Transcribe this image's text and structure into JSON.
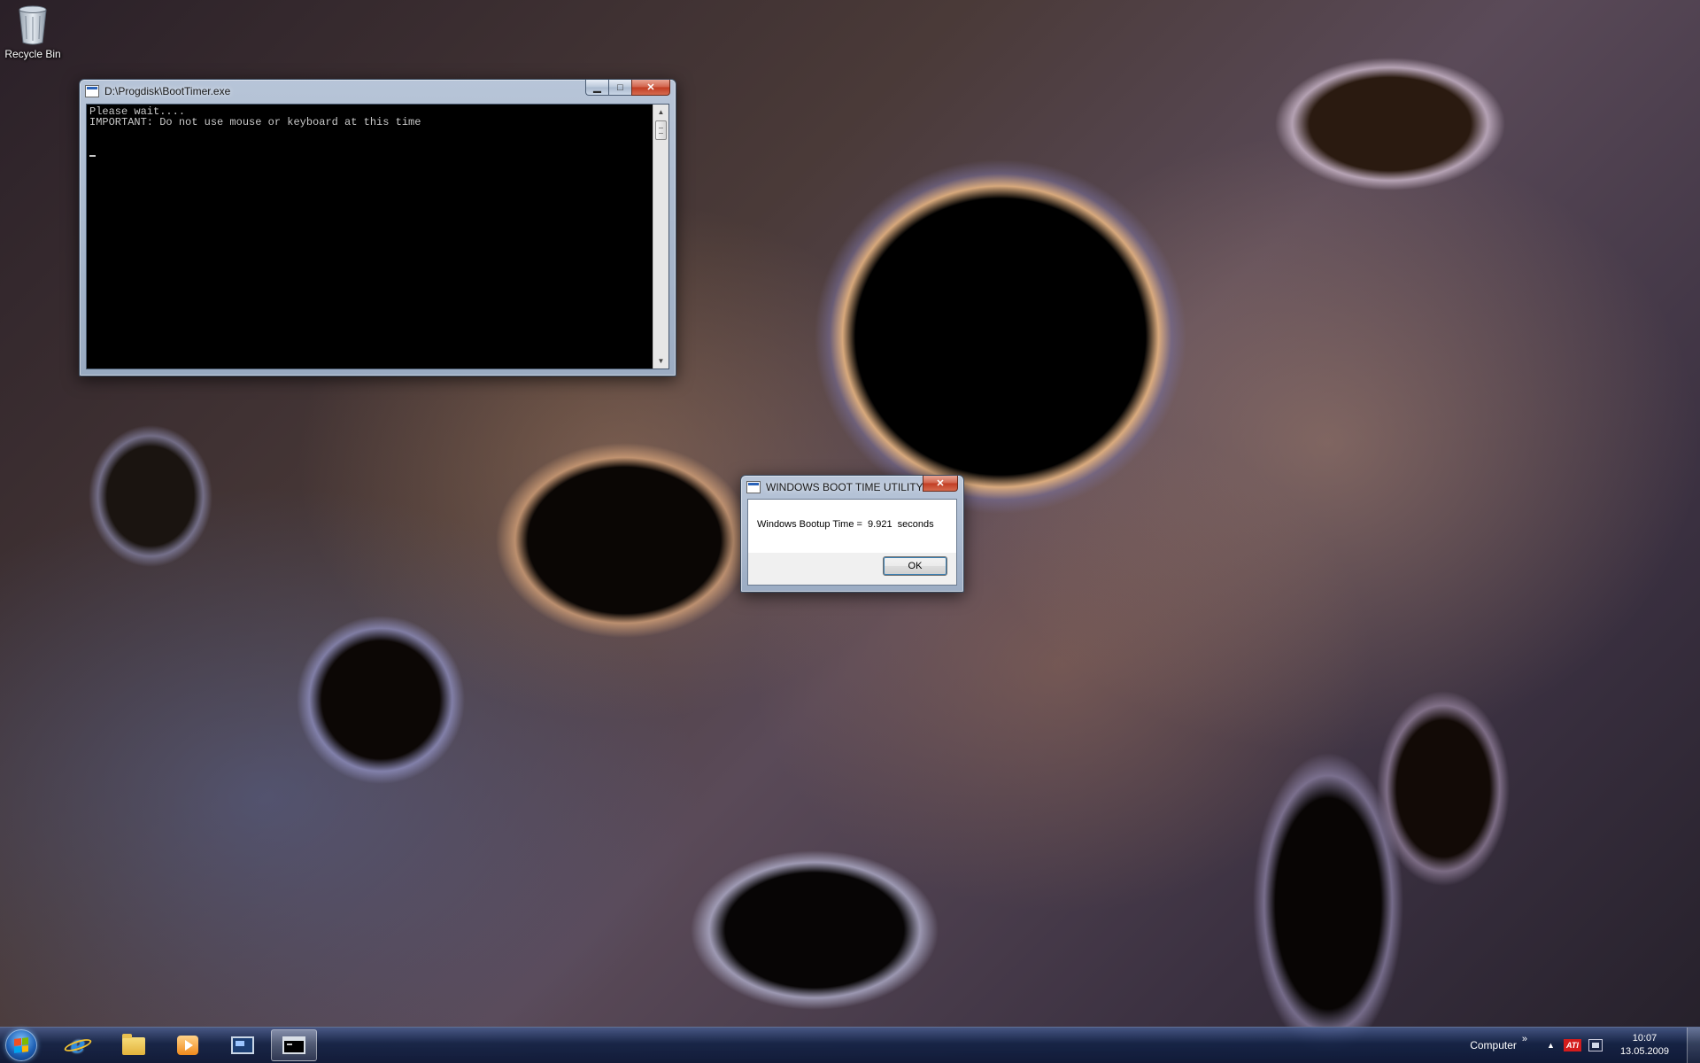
{
  "desktop": {
    "icons": [
      {
        "label": "Recycle Bin",
        "icon": "recycle-bin-icon"
      }
    ]
  },
  "console_window": {
    "title": "D:\\Progdisk\\BootTimer.exe",
    "lines": [
      "Please wait....",
      "IMPORTANT: Do not use mouse or keyboard at this time"
    ],
    "buttons": {
      "minimize": "▁",
      "maximize": "□",
      "close": "✕"
    }
  },
  "dialog": {
    "title": "WINDOWS BOOT TIME UTILITY",
    "message": "Windows Bootup Time =  9.921  seconds",
    "ok_label": "OK",
    "close": "✕"
  },
  "taskbar": {
    "pinned": [
      {
        "name": "internet-explorer",
        "icon": "internet-explorer-icon"
      },
      {
        "name": "windows-explorer",
        "icon": "folder-icon"
      },
      {
        "name": "media-player",
        "icon": "media-player-icon"
      },
      {
        "name": "remote-desktop",
        "icon": "monitor-icon"
      },
      {
        "name": "command-prompt",
        "icon": "console-icon",
        "active": true
      }
    ],
    "toolbar_label": "Computer",
    "toolbar_chevron": "»",
    "tray_arrow": "▲",
    "ati_label": "ATI",
    "clock": {
      "time": "10:07",
      "date": "13.05.2009"
    },
    "colors": {
      "accent": "#1e5fb3",
      "close_red": "#c13c22"
    }
  }
}
